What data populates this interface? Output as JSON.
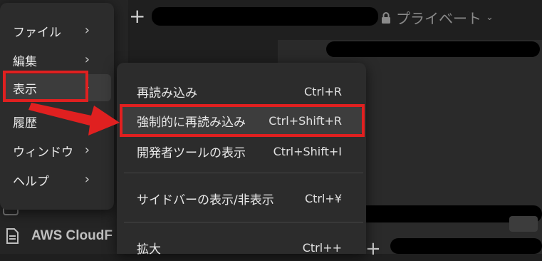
{
  "window": {
    "new_tab_icon": "plus-icon",
    "privacy_label": "プライベート",
    "bottom_doc_label": "AWS CloudF"
  },
  "main_menu": {
    "items": [
      {
        "label": "ファイル"
      },
      {
        "label": "編集"
      },
      {
        "label": "表示",
        "highlighted": true
      },
      {
        "label": "履歴"
      },
      {
        "label": "ウィンドウ"
      },
      {
        "label": "ヘルプ"
      }
    ]
  },
  "view_submenu": {
    "items": [
      {
        "label": "再読み込み",
        "shortcut": "Ctrl+R"
      },
      {
        "label": "強制的に再読み込み",
        "shortcut": "Ctrl+Shift+R",
        "highlighted": true
      },
      {
        "label": "開発者ツールの表示",
        "shortcut": "Ctrl+Shift+I"
      },
      {
        "label": "サイドバーの表示/非表示",
        "shortcut": "Ctrl+¥"
      },
      {
        "label": "拡大",
        "shortcut": "Ctrl++"
      }
    ]
  },
  "colors": {
    "annotation_red": "#e02020",
    "menu_bg": "#2c2c2c",
    "highlight_bg": "#3c3c3c"
  }
}
